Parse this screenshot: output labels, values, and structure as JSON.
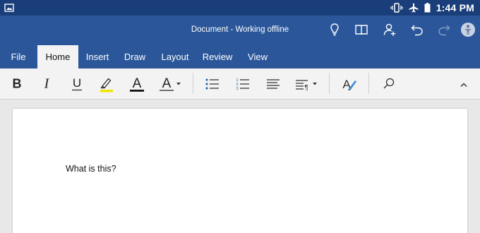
{
  "status_bar": {
    "time": "1:44 PM",
    "icons": [
      "image-icon",
      "vibrate-icon",
      "airplane-icon",
      "battery-icon"
    ],
    "background": "#1a3e7a"
  },
  "title_bar": {
    "title": "Document - Working offline",
    "icons": [
      "lightbulb-icon",
      "book-icon",
      "share-user-icon",
      "undo-icon",
      "redo-icon",
      "account-avatar-icon"
    ],
    "background": "#2b579a"
  },
  "tabs": [
    {
      "label": "File",
      "active": false
    },
    {
      "label": "Home",
      "active": true
    },
    {
      "label": "Insert",
      "active": false
    },
    {
      "label": "Draw",
      "active": false
    },
    {
      "label": "Layout",
      "active": false
    },
    {
      "label": "Review",
      "active": false
    },
    {
      "label": "View",
      "active": false
    }
  ],
  "toolbar": {
    "bold": "B",
    "italic": "I",
    "underline": "U",
    "font_color_glyph": "A",
    "text_color_glyph": "A",
    "highlight_color": "#f2e600",
    "font_color_underline": "#111111",
    "icons": [
      "highlight-icon",
      "bullets-icon",
      "numbering-icon",
      "align-icon",
      "paragraph-icon",
      "styles-icon",
      "search-icon",
      "collapse-icon"
    ]
  },
  "document": {
    "text": "What is this?"
  }
}
